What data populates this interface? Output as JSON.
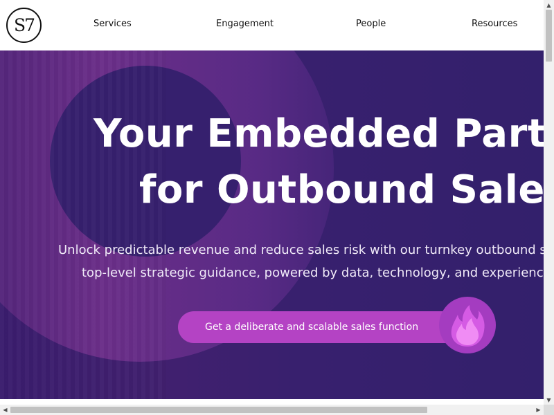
{
  "header": {
    "logo_text": "S7",
    "nav": [
      "Services",
      "Engagement",
      "People",
      "Resources"
    ]
  },
  "hero": {
    "headline_line1": "Your Embedded Partn",
    "headline_line2": "for Outbound Sales",
    "sub_line1": "Unlock predictable revenue and reduce sales risk with our turnkey outbound sa",
    "sub_line2": "top-level strategic guidance, powered by data, technology, and experience",
    "cta_label": "Get a deliberate and scalable sales function",
    "flame_icon": "flame-icon"
  },
  "scrollbars": {
    "up_arrow": "▲",
    "down_arrow": "▼",
    "left_arrow": "◀",
    "right_arrow": "▶"
  },
  "colors": {
    "hero_bg": "#36206e",
    "ring": "#6d2f8a",
    "cta": "#b443c4",
    "flame_badge": "#a43cc0",
    "flame_fill": "#f08cf4"
  }
}
